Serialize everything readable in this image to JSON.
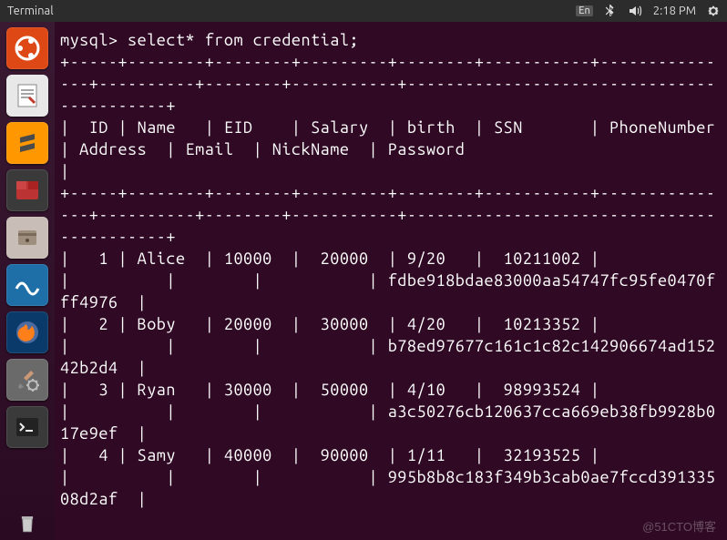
{
  "menubar": {
    "title": "Terminal",
    "lang": "En",
    "time": "2:18 PM"
  },
  "launcher": {
    "items": [
      {
        "name": "ubuntu-dash-icon"
      },
      {
        "name": "text-editor-icon"
      },
      {
        "name": "sublime-text-icon"
      },
      {
        "name": "terminator-icon"
      },
      {
        "name": "files-icon"
      },
      {
        "name": "wireshark-icon"
      },
      {
        "name": "firefox-icon"
      },
      {
        "name": "settings-icon"
      },
      {
        "name": "terminal-icon"
      }
    ],
    "trash": "trash-icon"
  },
  "terminal": {
    "prompt": "mysql> ",
    "command": "select* from credential;",
    "divider_top": "+-----+--------+--------+---------+--------+-----------+---------------+----------+--------+-----------+-------------------------------------------+",
    "header_row": "|  ID | Name   | EID    | Salary  | birth  | SSN       | PhoneNumber   | Address  | Email  | NickName  | Password                                  |",
    "divider_mid": "+-----+--------+--------+---------+--------+-----------+---------------+----------+--------+-----------+-------------------------------------------+",
    "rows": [
      "|   1 | Alice  | 10000  |  20000  | 9/20   |  10211002 |               |          |        |           | fdbe918bdae83000aa54747fc95fe0470fff4976  |",
      "|   2 | Boby   | 20000  |  30000  | 4/20   |  10213352 |               |          |        |           | b78ed97677c161c1c82c142906674ad15242b2d4  |",
      "|   3 | Ryan   | 30000  |  50000  | 4/10   |  98993524 |               |          |        |           | a3c50276cb120637cca669eb38fb9928b017e9ef  |",
      "|   4 | Samy   | 40000  |  90000  | 1/11   |  32193525 |               |          |        |           | 995b8b8c183f349b3cab0ae7fccd39133508d2af  |"
    ]
  },
  "watermark": "@51CTO博客",
  "chart_data": {
    "type": "table",
    "title": "credential",
    "columns": [
      "ID",
      "Name",
      "EID",
      "Salary",
      "birth",
      "SSN",
      "PhoneNumber",
      "Address",
      "Email",
      "NickName",
      "Password"
    ],
    "rows": [
      {
        "ID": 1,
        "Name": "Alice",
        "EID": 10000,
        "Salary": 20000,
        "birth": "9/20",
        "SSN": "10211002",
        "PhoneNumber": "",
        "Address": "",
        "Email": "",
        "NickName": "",
        "Password": "fdbe918bdae83000aa54747fc95fe0470fff4976"
      },
      {
        "ID": 2,
        "Name": "Boby",
        "EID": 20000,
        "Salary": 30000,
        "birth": "4/20",
        "SSN": "10213352",
        "PhoneNumber": "",
        "Address": "",
        "Email": "",
        "NickName": "",
        "Password": "b78ed97677c161c1c82c142906674ad15242b2d4"
      },
      {
        "ID": 3,
        "Name": "Ryan",
        "EID": 30000,
        "Salary": 50000,
        "birth": "4/10",
        "SSN": "98993524",
        "PhoneNumber": "",
        "Address": "",
        "Email": "",
        "NickName": "",
        "Password": "a3c50276cb120637cca669eb38fb9928b017e9ef"
      },
      {
        "ID": 4,
        "Name": "Samy",
        "EID": 40000,
        "Salary": 90000,
        "birth": "1/11",
        "SSN": "32193525",
        "PhoneNumber": "",
        "Address": "",
        "Email": "",
        "NickName": "",
        "Password": "995b8b8c183f349b3cab0ae7fccd39133508d2af"
      }
    ]
  }
}
